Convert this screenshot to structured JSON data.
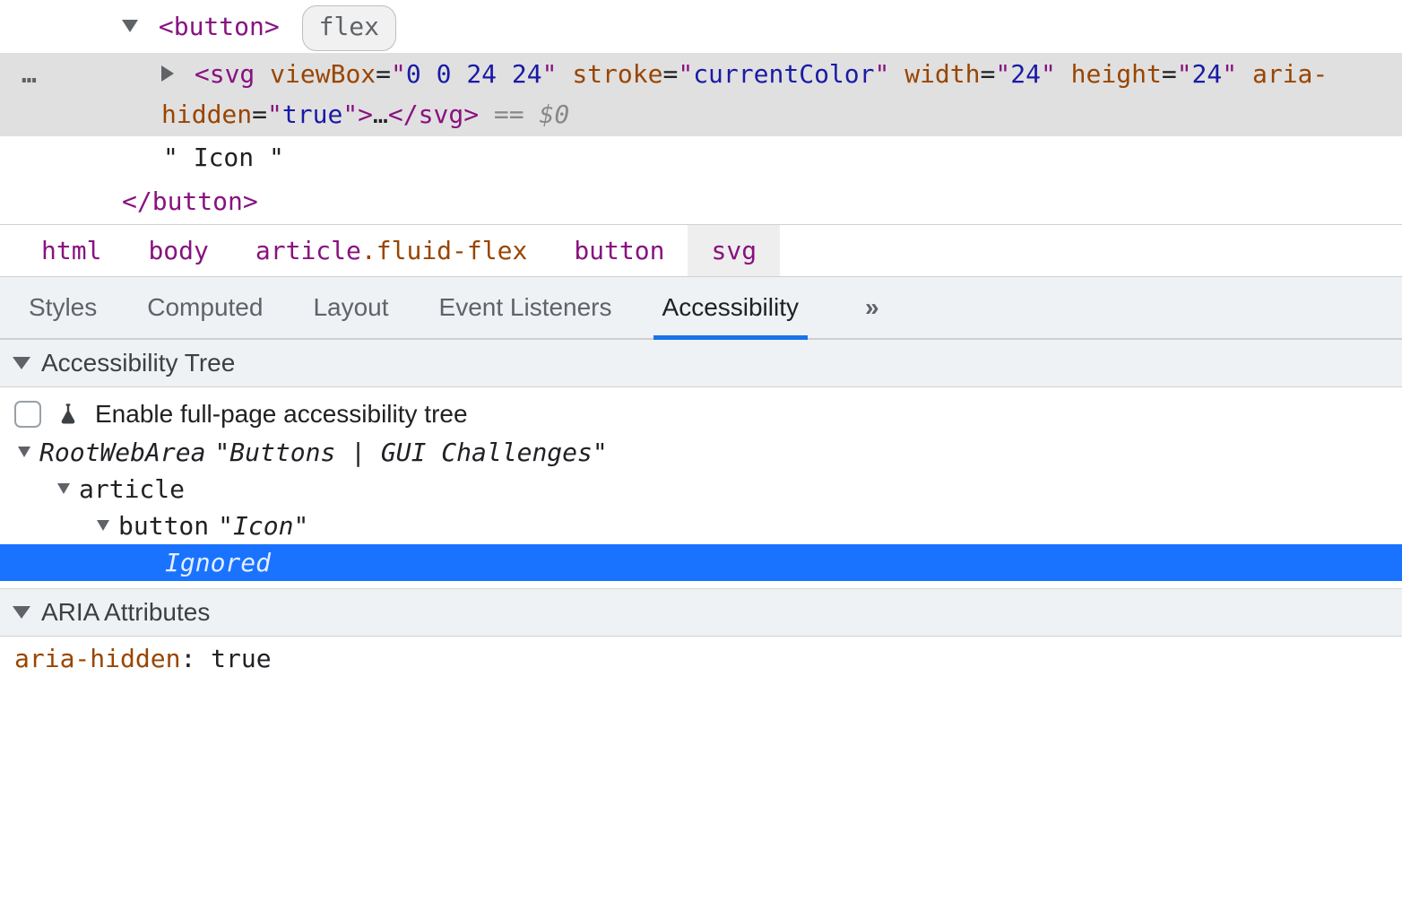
{
  "dom": {
    "row_button_open": {
      "lt": "<",
      "tag": "button",
      "gt": ">",
      "pill": "flex"
    },
    "row_svg": {
      "gutter": "…",
      "lt": "<",
      "tag": "svg",
      "attrs": [
        {
          "n": "viewBox",
          "v": "0 0 24 24"
        },
        {
          "n": "stroke",
          "v": "currentColor"
        },
        {
          "n": "width",
          "v": "24"
        },
        {
          "n": "height",
          "v": "24"
        },
        {
          "n": "aria-hidden",
          "v": "true"
        }
      ],
      "gt": ">",
      "ellipsis": "…",
      "close_lt": "</",
      "close_tag": "svg",
      "close_gt": ">",
      "eq0": " == $0"
    },
    "row_text": {
      "text": "\" Icon \""
    },
    "row_button_close": {
      "lt": "</",
      "tag": "button",
      "gt": ">"
    }
  },
  "breadcrumb": [
    {
      "label": "html"
    },
    {
      "label": "body"
    },
    {
      "label": "article",
      "class": ".fluid-flex"
    },
    {
      "label": "button"
    },
    {
      "label": "svg",
      "active": true
    }
  ],
  "paneTabs": {
    "items": [
      "Styles",
      "Computed",
      "Layout",
      "Event Listeners",
      "Accessibility"
    ],
    "activeIndex": 4,
    "more": "»"
  },
  "a11y": {
    "section1": "Accessibility Tree",
    "checkboxLabel": "Enable full-page accessibility tree",
    "tree": {
      "root_role": "RootWebArea",
      "root_name": "\"Buttons | GUI Challenges\"",
      "n1_role": "article",
      "n2_role": "button",
      "n2_name": "\"Icon\"",
      "ignored": "Ignored"
    },
    "section2": "ARIA Attributes",
    "aria_attr_name": "aria-hidden",
    "aria_attr_value": ": true"
  }
}
